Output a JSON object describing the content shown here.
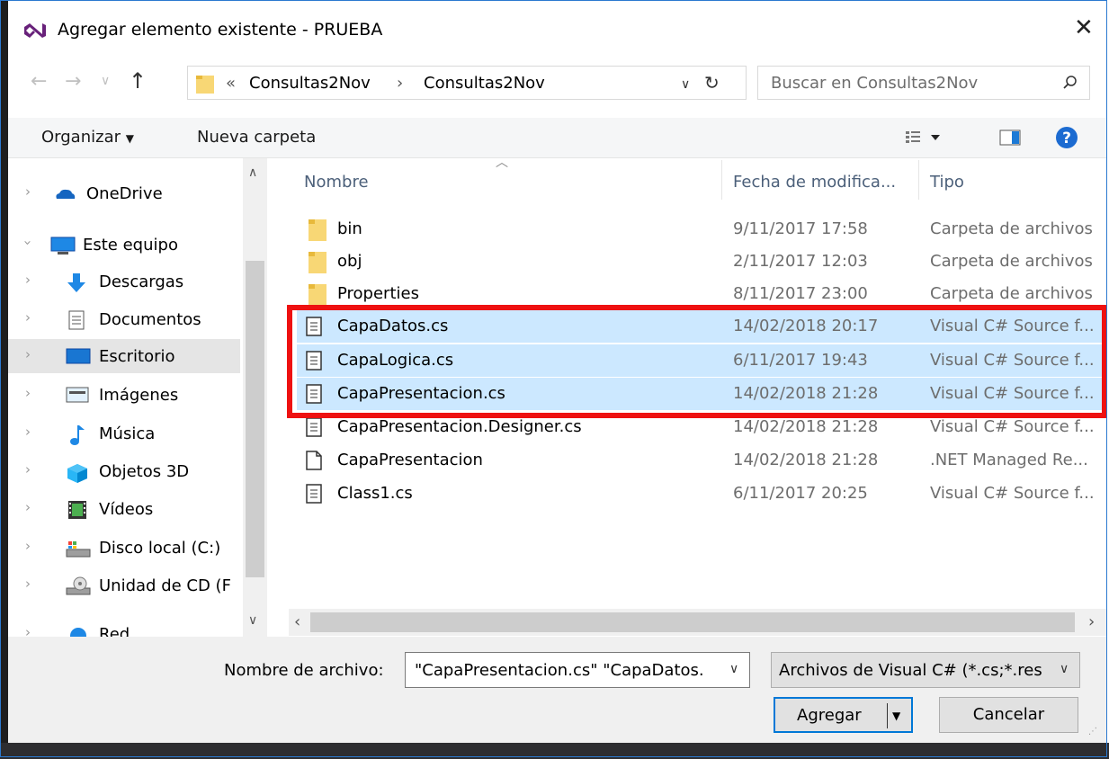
{
  "window": {
    "title": "Agregar elemento existente - PRUEBA",
    "close_glyph": "✕"
  },
  "address": {
    "overflow": "«",
    "crumbs": [
      "Consultas2Nov",
      "Consultas2Nov"
    ],
    "separator": "›",
    "search_placeholder": "Buscar en Consultas2Nov"
  },
  "toolbar": {
    "organize": "Organizar",
    "new_folder": "Nueva carpeta"
  },
  "nav": {
    "items": [
      {
        "label": "OneDrive",
        "icon": "onedrive-icon"
      },
      {
        "label": "Este equipo",
        "icon": "computer-icon"
      },
      {
        "label": "Descargas",
        "icon": "download-icon"
      },
      {
        "label": "Documentos",
        "icon": "documents-icon"
      },
      {
        "label": "Escritorio",
        "icon": "desktop-icon"
      },
      {
        "label": "Imágenes",
        "icon": "pictures-icon"
      },
      {
        "label": "Música",
        "icon": "music-icon"
      },
      {
        "label": "Objetos 3D",
        "icon": "3d-objects-icon"
      },
      {
        "label": "Vídeos",
        "icon": "videos-icon"
      },
      {
        "label": "Disco local (C:)",
        "icon": "local-disk-icon"
      },
      {
        "label": "Unidad de CD (F",
        "icon": "cd-drive-icon"
      },
      {
        "label": "Red",
        "icon": "network-icon"
      }
    ]
  },
  "columns": {
    "name": "Nombre",
    "date": "Fecha de modifica...",
    "type": "Tipo"
  },
  "files": [
    {
      "name": "bin",
      "date": "9/11/2017 17:58",
      "type": "Carpeta de archivos",
      "kind": "folder"
    },
    {
      "name": "obj",
      "date": "2/11/2017 12:03",
      "type": "Carpeta de archivos",
      "kind": "folder"
    },
    {
      "name": "Properties",
      "date": "8/11/2017 23:00",
      "type": "Carpeta de archivos",
      "kind": "folder"
    },
    {
      "name": "CapaDatos.cs",
      "date": "14/02/2018 20:17",
      "type": "Visual C# Source f...",
      "kind": "cs"
    },
    {
      "name": "CapaLogica.cs",
      "date": "6/11/2017 19:43",
      "type": "Visual C# Source f...",
      "kind": "cs"
    },
    {
      "name": "CapaPresentacion.cs",
      "date": "14/02/2018 21:28",
      "type": "Visual C# Source f...",
      "kind": "cs"
    },
    {
      "name": "CapaPresentacion.Designer.cs",
      "date": "14/02/2018 21:28",
      "type": "Visual C# Source f...",
      "kind": "cs"
    },
    {
      "name": "CapaPresentacion",
      "date": "14/02/2018 21:28",
      "type": ".NET Managed Re...",
      "kind": "resx"
    },
    {
      "name": "Class1.cs",
      "date": "6/11/2017 20:25",
      "type": "Visual C# Source f...",
      "kind": "cs"
    }
  ],
  "bottom": {
    "filename_label": "Nombre de archivo:",
    "filename_value": "\"CapaPresentacion.cs\" \"CapaDatos.",
    "filter_value": "Archivos de Visual C# (*.cs;*.res",
    "add_button": "Agregar",
    "cancel_button": "Cancelar"
  },
  "colors": {
    "accent": "#0078d7",
    "selection": "#cce8ff",
    "highlight_box": "#ee1111"
  }
}
